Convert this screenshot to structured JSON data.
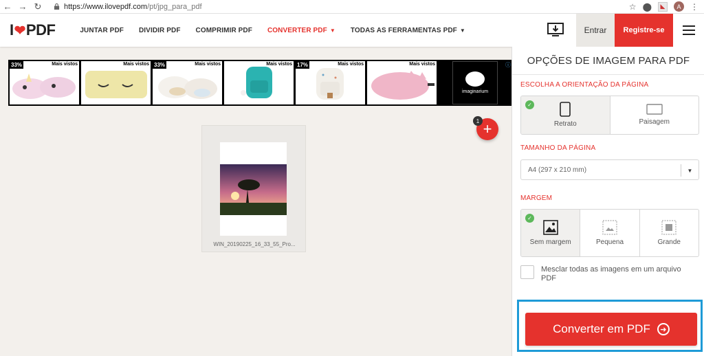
{
  "browser": {
    "url_host": "https://www.ilovepdf.com",
    "url_path": "/pt/jpg_para_pdf",
    "avatar_letter": "A"
  },
  "header": {
    "logo_left": "I",
    "logo_right": "PDF",
    "nav": [
      {
        "label": "JUNTAR PDF"
      },
      {
        "label": "DIVIDIR PDF"
      },
      {
        "label": "COMPRIMIR PDF"
      },
      {
        "label": "CONVERTER PDF",
        "active": true,
        "dropdown": true
      },
      {
        "label": "TODAS AS FERRAMENTAS PDF",
        "dropdown": true
      }
    ],
    "login": "Entrar",
    "register": "Registre-se"
  },
  "ads": {
    "items": [
      {
        "tag": "Mais vistos",
        "discount": "33%"
      },
      {
        "tag": "Mais vistos",
        "discount": ""
      },
      {
        "tag": "Mais vistos",
        "discount": "33%"
      },
      {
        "tag": "Mais vistos",
        "discount": ""
      },
      {
        "tag": "Mais vistos",
        "discount": "17%"
      },
      {
        "tag": "Mais vistos",
        "discount": ""
      }
    ],
    "brand": "imaginarium"
  },
  "workspace": {
    "file_count": "1",
    "file_name": "WIN_20190225_16_33_55_Pro..."
  },
  "panel": {
    "title": "OPÇÕES DE IMAGEM PARA PDF",
    "orientation_label": "ESCOLHA A ORIENTAÇÃO DA PÁGINA",
    "orientation_options": [
      "Retrato",
      "Paisagem"
    ],
    "size_label": "TAMANHO DA PÁGINA",
    "size_value": "A4 (297 x 210 mm)",
    "margin_label": "MARGEM",
    "margin_options": [
      "Sem margem",
      "Pequena",
      "Grande"
    ],
    "merge_text": "Mesclar todas as imagens em um arquivo PDF",
    "convert_label": "Converter em PDF"
  },
  "colors": {
    "brand_red": "#e5322d",
    "highlight_blue": "#1e9bd7",
    "check_green": "#5db85b"
  }
}
